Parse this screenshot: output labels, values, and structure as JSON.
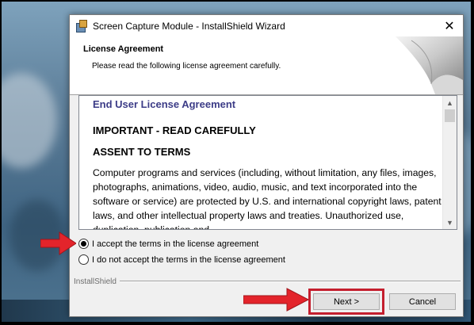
{
  "window": {
    "title": "Screen Capture Module - InstallShield Wizard",
    "close_glyph": "✕"
  },
  "header": {
    "title": "License Agreement",
    "subtitle": "Please read the following license agreement carefully."
  },
  "license": {
    "heading": "End User License Agreement",
    "important": "IMPORTANT - READ CAREFULLY",
    "assent": "ASSENT TO TERMS",
    "body": "Computer programs and services (including, without limitation, any files, images, photographs, animations, video, audio, music, and text incorporated into the software or service) are protected by U.S. and international copyright laws, patent laws, and other intellectual property laws and treaties. Unauthorized use, duplication, publication and"
  },
  "options": [
    {
      "label": "I accept the terms in the license agreement",
      "selected": true
    },
    {
      "label": "I do not accept the terms in the license agreement",
      "selected": false
    }
  ],
  "footer": {
    "brand": "InstallShield",
    "next_label": "Next >",
    "cancel_label": "Cancel"
  },
  "scroll_arrows": {
    "up": "▲",
    "down": "▼"
  },
  "colors": {
    "heading_blue": "#3c3c87",
    "highlight_red": "#c41f2e"
  },
  "icons": [
    "installer-app-icon",
    "close-icon",
    "page-curl-graphic",
    "red-arrow-icon"
  ]
}
